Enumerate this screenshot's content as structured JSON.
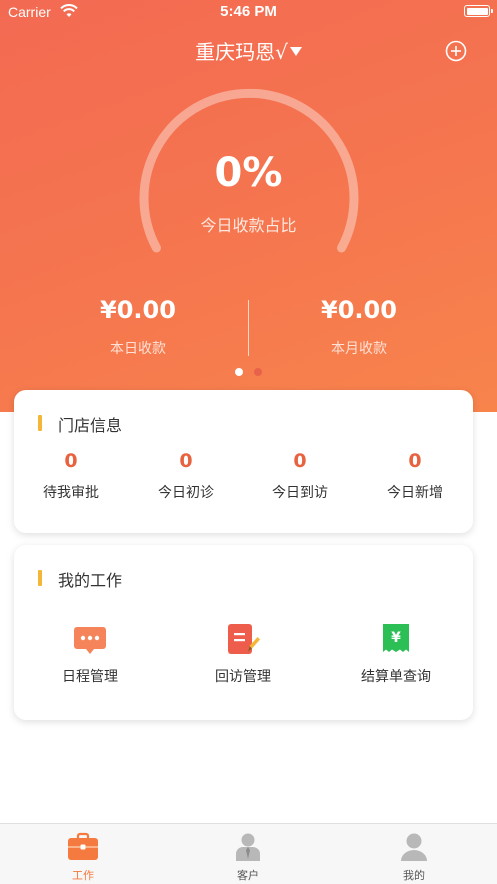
{
  "status_bar": {
    "carrier": "Carrier",
    "time": "5:46 PM"
  },
  "header": {
    "store_name": "重庆玛恩√"
  },
  "gauge": {
    "value_text": "0%",
    "label": "今日收款占比",
    "fraction": 0
  },
  "totals": {
    "today_amount": "¥0.00",
    "today_label": "本日收款",
    "month_amount": "¥0.00",
    "month_label": "本月收款"
  },
  "pager": {
    "count": 2,
    "active": 0
  },
  "store_info": {
    "title": "门店信息",
    "stats": [
      {
        "value": "0",
        "label": "待我审批"
      },
      {
        "value": "0",
        "label": "今日初诊"
      },
      {
        "value": "0",
        "label": "今日到访"
      },
      {
        "value": "0",
        "label": "今日新增"
      }
    ]
  },
  "my_work": {
    "title": "我的工作",
    "items": [
      {
        "label": "日程管理",
        "icon": "schedule-chat-icon"
      },
      {
        "label": "回访管理",
        "icon": "followup-note-icon"
      },
      {
        "label": "结算单查询",
        "icon": "receipt-yen-icon"
      }
    ]
  },
  "tabbar": {
    "items": [
      {
        "label": "工作",
        "icon": "briefcase-icon",
        "active": true
      },
      {
        "label": "客户",
        "icon": "customer-icon",
        "active": false
      },
      {
        "label": "我的",
        "icon": "profile-icon",
        "active": false
      }
    ]
  },
  "colors": {
    "brand": "#f36a52",
    "accent_bar": "#f5b638",
    "stat_value": "#e8623f",
    "tab_active": "#f47a3f",
    "tab_inactive": "#555555"
  }
}
